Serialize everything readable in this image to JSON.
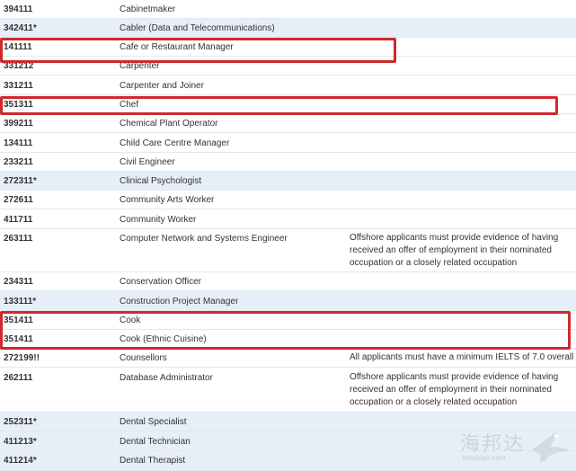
{
  "rows": [
    {
      "code": "394111",
      "occupation": "Cabinetmaker",
      "note": ""
    },
    {
      "code": "342411*",
      "occupation": "Cabler (Data and Telecommunications)",
      "note": ""
    },
    {
      "code": "141111",
      "occupation": "Cafe or Restaurant Manager",
      "note": ""
    },
    {
      "code": "331212",
      "occupation": "Carpenter",
      "note": ""
    },
    {
      "code": "331211",
      "occupation": "Carpenter and Joiner",
      "note": ""
    },
    {
      "code": "351311",
      "occupation": "Chef",
      "note": ""
    },
    {
      "code": "399211",
      "occupation": "Chemical Plant Operator",
      "note": ""
    },
    {
      "code": "134111",
      "occupation": "Child Care Centre Manager",
      "note": ""
    },
    {
      "code": "233211",
      "occupation": "Civil Engineer",
      "note": ""
    },
    {
      "code": "272311*",
      "occupation": "Clinical Psychologist",
      "note": ""
    },
    {
      "code": "272611",
      "occupation": "Community Arts Worker",
      "note": ""
    },
    {
      "code": "411711",
      "occupation": "Community Worker",
      "note": ""
    },
    {
      "code": "263111",
      "occupation": "Computer Network and Systems Engineer",
      "note": "Offshore applicants must provide evidence of having received an offer of employment in their nominated occupation or a closely related occupation"
    },
    {
      "code": "234311",
      "occupation": "Conservation Officer",
      "note": ""
    },
    {
      "code": "133111*",
      "occupation": "Construction Project Manager",
      "note": ""
    },
    {
      "code": "351411",
      "occupation": "Cook",
      "note": ""
    },
    {
      "code": "351411",
      "occupation": "Cook (Ethnic Cuisine)",
      "note": ""
    },
    {
      "code": "272199!!",
      "occupation": "Counsellors",
      "note": "All applicants must have a minimum IELTS of 7.0 overall"
    },
    {
      "code": "262111",
      "occupation": "Database Administrator",
      "note": "Offshore applicants must  provide evidence of having received an offer of employment in their nominated occupation or a closely related occupation"
    },
    {
      "code": "252311*",
      "occupation": "Dental Specialist",
      "note": ""
    },
    {
      "code": "411213*",
      "occupation": "Dental Technician",
      "note": ""
    },
    {
      "code": "411214*",
      "occupation": "Dental Therapist",
      "note": ""
    }
  ],
  "watermark": {
    "text": "海邦达",
    "url": "hinabian.com"
  },
  "colors": {
    "highlight_row": "#e6eef8",
    "marker": "#d0282e",
    "border": "#e3e8ee"
  },
  "icons": {
    "watermark_logo": "bird-icon"
  }
}
